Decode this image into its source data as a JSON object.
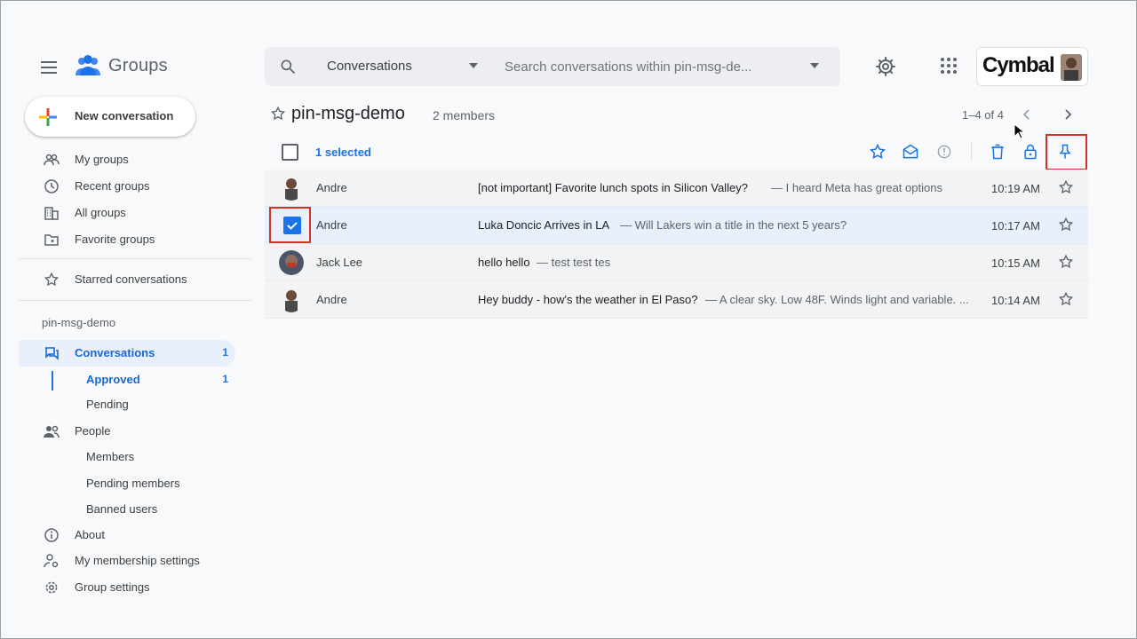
{
  "app": {
    "title": "Groups"
  },
  "search": {
    "scope": "Conversations",
    "placeholder": "Search conversations within pin-msg-de..."
  },
  "account": {
    "brand": "Cymbal"
  },
  "sidebar": {
    "new_conversation": "New conversation",
    "nav": [
      {
        "label": "My groups",
        "icon": "my-groups-icon"
      },
      {
        "label": "Recent groups",
        "icon": "clock-icon"
      },
      {
        "label": "All groups",
        "icon": "building-icon"
      },
      {
        "label": "Favorite groups",
        "icon": "folder-star-icon"
      }
    ],
    "starred": "Starred conversations",
    "group_section": "pin-msg-demo",
    "conversations": {
      "label": "Conversations",
      "count": "1"
    },
    "approved": {
      "label": "Approved",
      "count": "1"
    },
    "pending": "Pending",
    "people": "People",
    "members": "Members",
    "pending_members": "Pending members",
    "banned_users": "Banned users",
    "about": "About",
    "membership_settings": "My membership settings",
    "group_settings": "Group settings"
  },
  "main": {
    "group_name": "pin-msg-demo",
    "members": "2 members",
    "pager": "1–4 of 4",
    "selected_label": "1 selected",
    "rows": [
      {
        "author": "Andre",
        "subject": "[not important] Favorite lunch spots in Silicon Valley?",
        "snippet": "— I heard Meta has great options",
        "time": "10:19 AM",
        "selected": false
      },
      {
        "author": "Andre",
        "subject": "Luka Doncic Arrives in LA",
        "snippet": "— Will Lakers win a title in the next 5 years?",
        "time": "10:17 AM",
        "selected": true
      },
      {
        "author": "Jack Lee",
        "subject": "hello hello",
        "snippet": "— test test tes",
        "time": "10:15 AM",
        "selected": false
      },
      {
        "author": "Andre",
        "subject": "Hey buddy - how's the weather in El Paso?",
        "snippet": "— A clear sky. Low 48F. Winds light and variable. ...",
        "time": "10:14 AM",
        "selected": false
      }
    ]
  },
  "colors": {
    "accent": "#1a73e8",
    "highlight": "#d93025",
    "selected_row": "#e8f0fe"
  }
}
